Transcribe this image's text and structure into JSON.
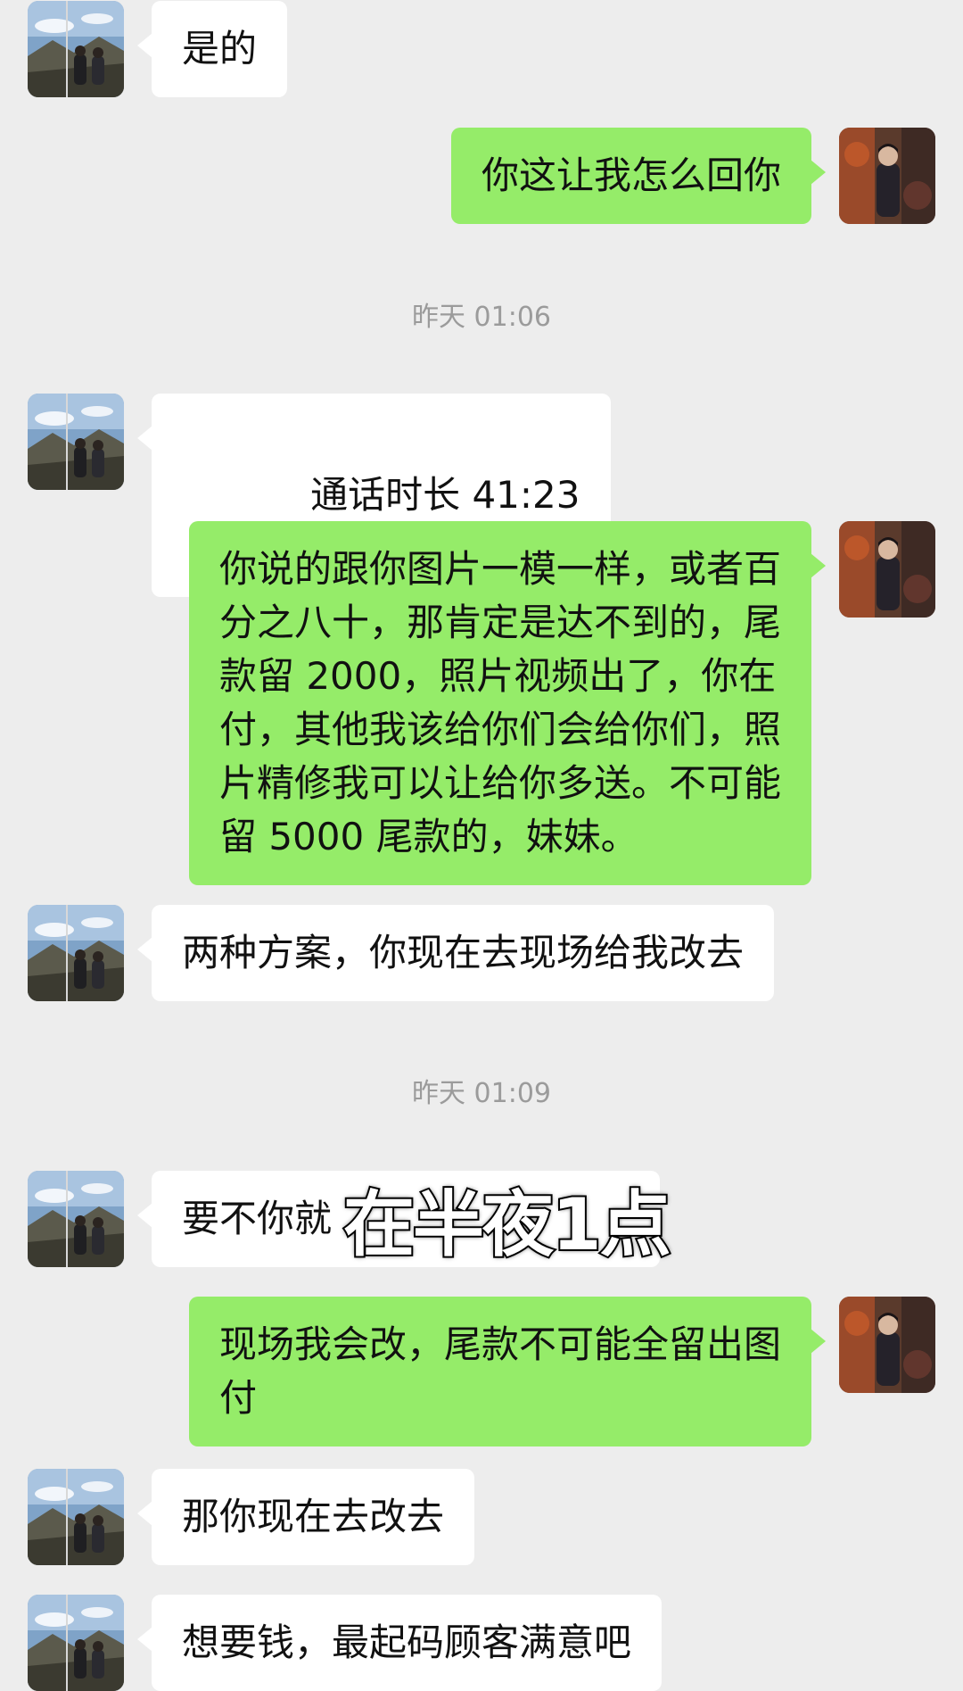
{
  "chat": {
    "timestamps": {
      "t1": "昨天 01:06",
      "t2": "昨天 01:09"
    },
    "messages": [
      {
        "side": "in",
        "text": "是的"
      },
      {
        "side": "out",
        "text": "你这让我怎么回你"
      },
      {
        "side": "in",
        "type": "call",
        "icon": "phone-hangup-icon",
        "text": "通话时长 41:23"
      },
      {
        "side": "out",
        "text": "你说的跟你图片一模一样，或者百\n分之八十，那肯定是达不到的，尾\n款留 2000，照片视频出了，你在\n付，其他我该给你们会给你们，照\n片精修我可以让给你多送。不可能\n留 5000 尾款的，妹妹。"
      },
      {
        "side": "in",
        "text": "两种方案，你现在去现场给我改去"
      },
      {
        "side": "in",
        "text": "要不你就"
      },
      {
        "side": "out",
        "text": "现场我会改，尾款不可能全留出图\n付"
      },
      {
        "side": "in",
        "text": "那你现在去改去"
      },
      {
        "side": "in",
        "text": "想要钱，最起码顾客满意吧"
      }
    ]
  },
  "overlay": {
    "caption": "在半夜1点"
  },
  "colors": {
    "background": "#ededed",
    "incoming_bubble": "#ffffff",
    "outgoing_bubble": "#95ec69",
    "timestamp_text": "#9b9b9b"
  }
}
